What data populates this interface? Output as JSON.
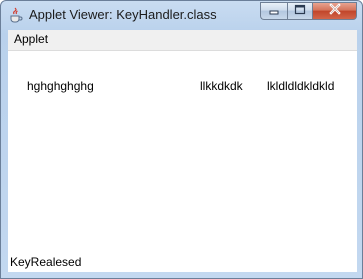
{
  "window": {
    "title": "Applet Viewer: KeyHandler.class",
    "app_icon": "java-cup-icon",
    "caption_buttons": {
      "minimize": "minimize-icon",
      "maximize": "maximize-icon",
      "close": "close-icon"
    }
  },
  "menubar": {
    "items": [
      {
        "label": "Applet"
      }
    ]
  },
  "applet": {
    "texts": [
      "hghghghghg",
      "llkkdkdk",
      "lkldldldkldkld"
    ]
  },
  "status": {
    "text": "KeyRealesed"
  },
  "colors": {
    "titlebar": "#c3d8f0",
    "close_button": "#c1452a",
    "menubar_bg": "#f0f0f0",
    "client_bg": "#ffffff"
  }
}
